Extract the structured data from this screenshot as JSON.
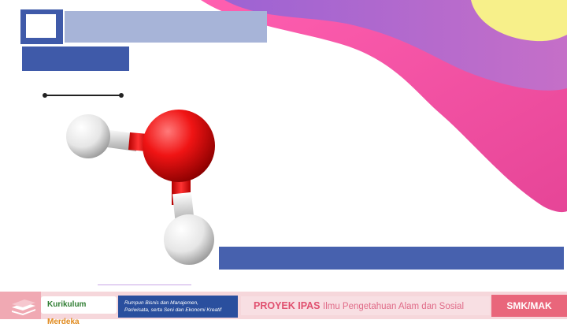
{
  "footer": {
    "kurikulum_word1": "Kurikulum",
    "kurikulum_word2": "Merdeka",
    "rumpun_line1": "Rumpun Bisnis dan Manajemen,",
    "rumpun_line2": "Pariwisata, serta Seni dan Ekonomi Kreatif",
    "proyek_title": "PROYEK IPAS",
    "proyek_subtitle": "Ilmu Pengetahuan Alam dan Sosial",
    "level": "SMK/MAK"
  },
  "colors": {
    "primary_blue": "#3f5aa9",
    "light_blue": "#a7b4d8",
    "oxygen_red": "#e81a1a",
    "hydrogen_white": "#f2f2f2",
    "blob_pink": "#e94fa6",
    "blob_purple": "#b06ad2",
    "blob_yellow": "#f7f08a",
    "footer_pink": "#f6d7db"
  },
  "molecule": {
    "atoms": [
      "hydrogen",
      "oxygen",
      "hydrogen"
    ]
  }
}
